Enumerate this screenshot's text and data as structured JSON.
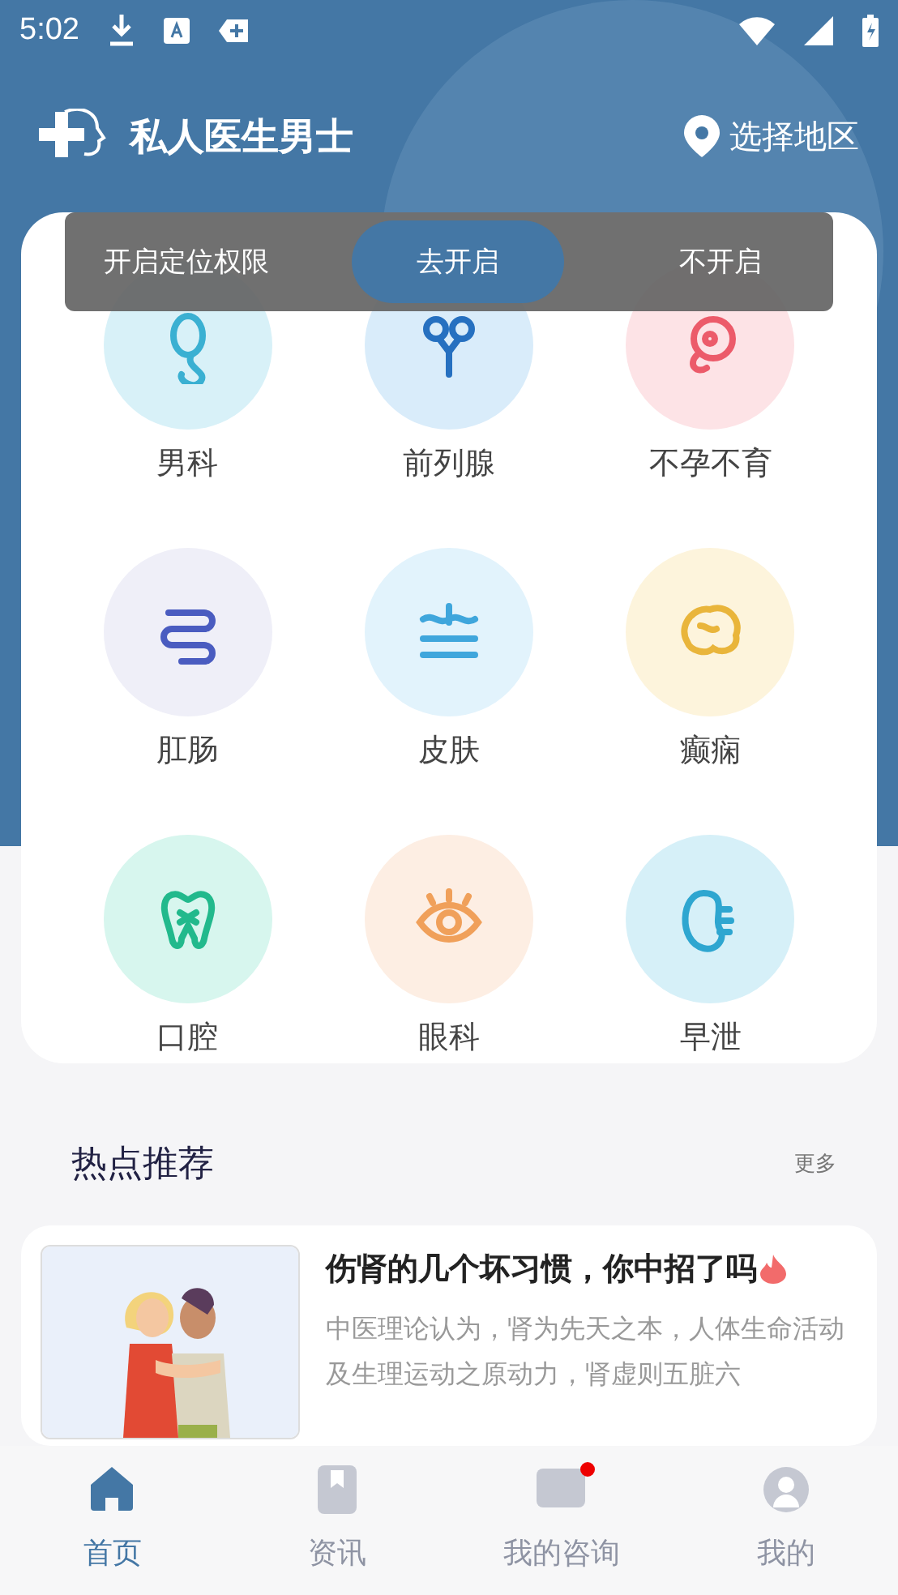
{
  "status_bar": {
    "time": "5:02"
  },
  "header": {
    "app_name": "私人医生男士",
    "location": "选择地区"
  },
  "permission_toast": {
    "message": "开启定位权限",
    "confirm": "去开启",
    "cancel": "不开启"
  },
  "departments": [
    {
      "label": "男科"
    },
    {
      "label": "前列腺"
    },
    {
      "label": "不孕不育"
    },
    {
      "label": "肛肠"
    },
    {
      "label": "皮肤"
    },
    {
      "label": "癫痫"
    },
    {
      "label": "口腔"
    },
    {
      "label": "眼科"
    },
    {
      "label": "早泄"
    }
  ],
  "hot": {
    "title": "热点推荐",
    "more": "更多",
    "articles": [
      {
        "title": "伤肾的几个坏习惯，你中招了吗",
        "summary": "中医理论认为，肾为先天之本，人体生命活动及生理运动之原动力，肾虚则五脏六"
      }
    ]
  },
  "tabs": [
    {
      "label": "首页",
      "selected": true,
      "badge": false
    },
    {
      "label": "资讯",
      "selected": false,
      "badge": false
    },
    {
      "label": "我的咨询",
      "selected": false,
      "badge": true
    },
    {
      "label": "我的",
      "selected": false,
      "badge": false
    }
  ]
}
